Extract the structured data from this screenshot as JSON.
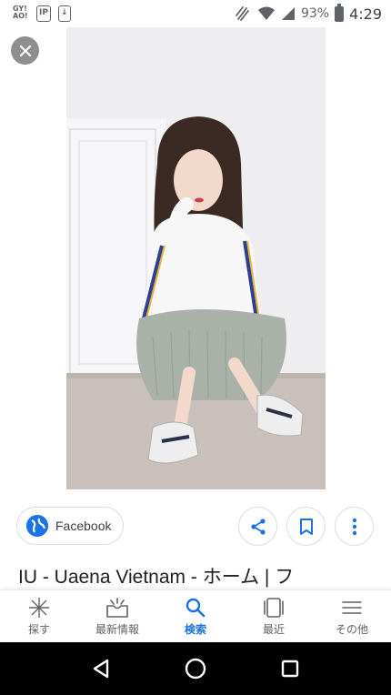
{
  "status_bar": {
    "left_icons": [
      "GY! AO!",
      "IP",
      "↓"
    ],
    "battery_percent": "93%",
    "time": "4:29"
  },
  "viewer": {
    "close_icon": "close-icon",
    "photo_description_icon": "photo"
  },
  "source": {
    "label": "Facebook",
    "icon": "globe-icon"
  },
  "actions": {
    "share_icon": "share-icon",
    "bookmark_icon": "bookmark-icon",
    "more_icon": "more-vert-icon"
  },
  "result": {
    "title": "IU - Uaena Vietnam - ホーム | フ"
  },
  "bottom_nav": {
    "items": [
      {
        "label": "探す",
        "icon": "discover-icon"
      },
      {
        "label": "最新情報",
        "icon": "updates-icon"
      },
      {
        "label": "検索",
        "icon": "search-icon"
      },
      {
        "label": "最近",
        "icon": "recent-icon"
      },
      {
        "label": "その他",
        "icon": "menu-icon"
      }
    ],
    "active_index": 2
  },
  "colors": {
    "accent": "#1a73e8",
    "icon_gray": "#5f6368",
    "border": "#dadce0"
  }
}
